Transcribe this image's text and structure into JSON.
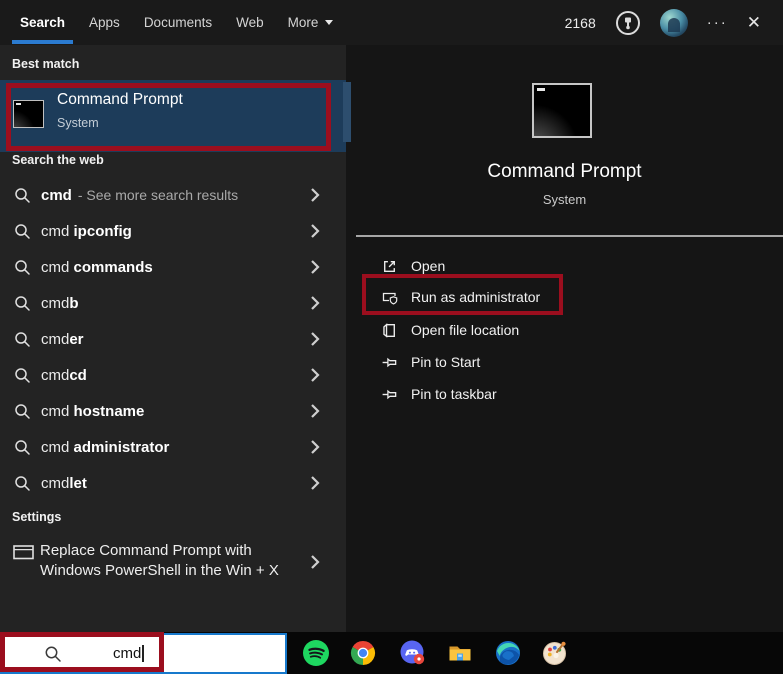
{
  "colors": {
    "accent_blue": "#2b7bd0",
    "selection_blue": "#1d3c5a",
    "annotation_red": "#9b0e1e"
  },
  "topbar": {
    "tabs": [
      {
        "label": "Search",
        "active": true
      },
      {
        "label": "Apps",
        "active": false
      },
      {
        "label": "Documents",
        "active": false
      },
      {
        "label": "Web",
        "active": false
      },
      {
        "label": "More",
        "active": false,
        "has_dropdown": true
      }
    ],
    "rewards_points": "2168",
    "more_options_glyph": "···",
    "close_glyph": "✕",
    "icons": [
      "rewards-trophy-icon",
      "user-avatar",
      "more-options-icon",
      "close-icon"
    ]
  },
  "left_panel": {
    "best_match": {
      "header": "Best match",
      "app_name": "Command Prompt",
      "app_type": "System"
    },
    "search_web": {
      "header": "Search the web",
      "see_more": {
        "query": "cmd",
        "label": "- See more search results"
      },
      "items": [
        {
          "pre": "cmd ",
          "bold": "ipconfig"
        },
        {
          "pre": "cmd ",
          "bold": "commands"
        },
        {
          "pre": "cmd",
          "bold": "b"
        },
        {
          "pre": "cmd",
          "bold": "er"
        },
        {
          "pre": "cmd",
          "bold": "cd"
        },
        {
          "pre": "cmd ",
          "bold": "hostname"
        },
        {
          "pre": "cmd ",
          "bold": "administrator"
        },
        {
          "pre": "cmd",
          "bold": "let"
        }
      ]
    },
    "settings": {
      "header": "Settings",
      "item_line1": "Replace Command Prompt with",
      "item_line2": "Windows PowerShell in the Win + X"
    }
  },
  "right_panel": {
    "app_name": "Command Prompt",
    "app_type": "System",
    "actions": [
      {
        "label": "Open",
        "icon": "open-icon"
      },
      {
        "label": "Run as administrator",
        "icon": "admin-shield-icon",
        "annotated": true
      },
      {
        "label": "Open file location",
        "icon": "file-location-icon"
      },
      {
        "label": "Pin to Start",
        "icon": "pin-icon"
      },
      {
        "label": "Pin to taskbar",
        "icon": "pin-icon"
      }
    ]
  },
  "taskbar": {
    "search_value": "cmd",
    "icons": [
      "spotify",
      "chrome",
      "discord",
      "file-explorer",
      "edge",
      "paint"
    ]
  }
}
